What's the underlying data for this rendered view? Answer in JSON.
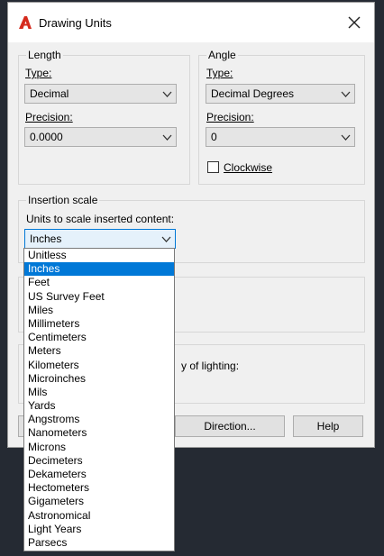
{
  "window": {
    "title": "Drawing Units"
  },
  "length": {
    "group_label": "Length",
    "type_label": "Type:",
    "type_value": "Decimal",
    "precision_label": "Precision:",
    "precision_value": "0.0000"
  },
  "angle": {
    "group_label": "Angle",
    "type_label": "Type:",
    "type_value": "Decimal Degrees",
    "precision_label": "Precision:",
    "precision_value": "0",
    "clockwise_label": "Clockwise"
  },
  "insertion": {
    "group_label": "Insertion scale",
    "units_label": "Units to scale inserted content:",
    "units_value": "Inches",
    "options": [
      "Unitless",
      "Inches",
      "Feet",
      "US Survey Feet",
      "Miles",
      "Millimeters",
      "Centimeters",
      "Meters",
      "Kilometers",
      "Microinches",
      "Mils",
      "Yards",
      "Angstroms",
      "Nanometers",
      "Microns",
      "Decimeters",
      "Dekameters",
      "Hectometers",
      "Gigameters",
      "Astronomical",
      "Light Years",
      "Parsecs"
    ],
    "selected_index": 1
  },
  "lighting": {
    "partial_label": "y of lighting:"
  },
  "buttons": {
    "direction": "Direction...",
    "help": "Help"
  },
  "colors": {
    "selection": "#0078d7",
    "app_icon": "#d52b1e"
  },
  "icons": {
    "app": "autocad-logo-icon",
    "close": "close-icon",
    "dropdown": "chevron-down-icon"
  }
}
